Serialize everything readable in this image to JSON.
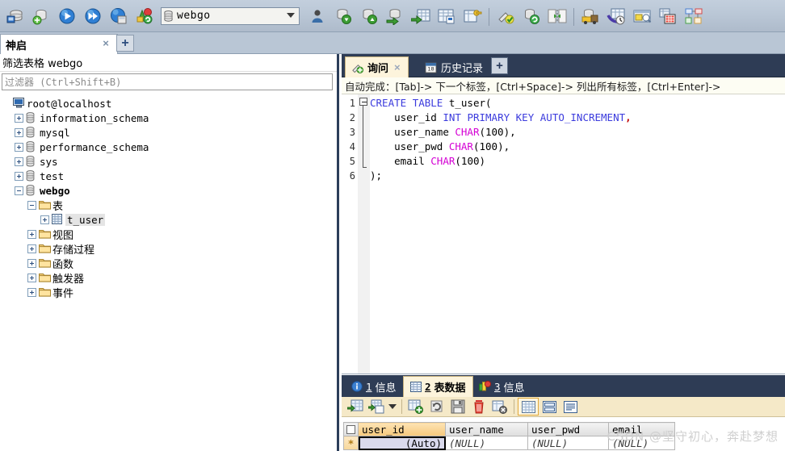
{
  "toolbar": {
    "db_selector": {
      "value": "webgo",
      "icon": "database-icon"
    },
    "buttons": [
      {
        "name": "connect-icon",
        "title": "连接"
      },
      {
        "name": "new-connection-icon",
        "title": "新建连接"
      },
      {
        "name": "execute-icon",
        "title": "执行"
      },
      {
        "name": "execute-all-icon",
        "title": "执行全部"
      },
      {
        "name": "stop-icon",
        "title": "停止"
      },
      {
        "name": "refresh-objects-icon",
        "title": "刷新"
      },
      {
        "name": "user-manager-icon",
        "title": "用户管理"
      },
      {
        "name": "backup-database-icon",
        "title": "备份数据库"
      },
      {
        "name": "restore-database-icon",
        "title": "还原数据库"
      },
      {
        "name": "import-data-icon",
        "title": "导入数据"
      },
      {
        "name": "export-grid-icon",
        "title": "导出表格"
      },
      {
        "name": "table-diagnostics-icon",
        "title": "表诊断"
      },
      {
        "name": "manage-index-icon",
        "title": "索引管理"
      },
      {
        "name": "query-builder-icon",
        "title": "查询生成器"
      },
      {
        "name": "schema-sync-icon",
        "title": "结构同步"
      },
      {
        "name": "data-sync-icon",
        "title": "数据同步"
      },
      {
        "name": "scheduled-backup-icon",
        "title": "计划备份"
      },
      {
        "name": "sql-scheduler-icon",
        "title": "SQL 调度"
      },
      {
        "name": "form-view-icon",
        "title": "表单视图"
      },
      {
        "name": "html-export-icon",
        "title": "HTML 导出"
      },
      {
        "name": "schema-designer-icon",
        "title": "结构设计器"
      }
    ]
  },
  "connection_tab": {
    "label": "神启",
    "close": "×",
    "add": "+"
  },
  "left_panel": {
    "title": "筛选表格 webgo",
    "filter_placeholder": "过滤器 (Ctrl+Shift+B)",
    "tree": [
      {
        "label": "root@localhost",
        "icon": "host-icon",
        "indent": 0,
        "expander": "none",
        "bold": false,
        "cjk": false
      },
      {
        "label": "information_schema",
        "icon": "database-icon",
        "indent": 1,
        "expander": "plus",
        "bold": false,
        "cjk": false
      },
      {
        "label": "mysql",
        "icon": "database-icon",
        "indent": 1,
        "expander": "plus",
        "bold": false,
        "cjk": false
      },
      {
        "label": "performance_schema",
        "icon": "database-icon",
        "indent": 1,
        "expander": "plus",
        "bold": false,
        "cjk": false
      },
      {
        "label": "sys",
        "icon": "database-icon",
        "indent": 1,
        "expander": "plus",
        "bold": false,
        "cjk": false
      },
      {
        "label": "test",
        "icon": "database-icon",
        "indent": 1,
        "expander": "plus",
        "bold": false,
        "cjk": false
      },
      {
        "label": "webgo",
        "icon": "database-icon",
        "indent": 1,
        "expander": "minus",
        "bold": true,
        "cjk": false
      },
      {
        "label": "表",
        "icon": "folder-icon",
        "indent": 2,
        "expander": "minus",
        "bold": false,
        "cjk": true
      },
      {
        "label": "t_user",
        "icon": "table-icon",
        "indent": 3,
        "expander": "plus",
        "bold": false,
        "cjk": false,
        "selected": true
      },
      {
        "label": "视图",
        "icon": "folder-icon",
        "indent": 2,
        "expander": "plus",
        "bold": false,
        "cjk": true
      },
      {
        "label": "存储过程",
        "icon": "folder-icon",
        "indent": 2,
        "expander": "plus",
        "bold": false,
        "cjk": true
      },
      {
        "label": "函数",
        "icon": "folder-icon",
        "indent": 2,
        "expander": "plus",
        "bold": false,
        "cjk": true
      },
      {
        "label": "触发器",
        "icon": "folder-icon",
        "indent": 2,
        "expander": "plus",
        "bold": false,
        "cjk": true
      },
      {
        "label": "事件",
        "icon": "folder-icon",
        "indent": 2,
        "expander": "plus",
        "bold": false,
        "cjk": true
      }
    ]
  },
  "query_panel": {
    "tabs": [
      {
        "label": "询问",
        "icon": "query-icon",
        "active": true,
        "closable": true
      },
      {
        "label": "历史记录",
        "icon": "calendar-icon",
        "active": false,
        "closable": false
      }
    ],
    "add_tab": "+",
    "close_tab": "×",
    "autocomplete_hint": "自动完成：[Tab]-> 下一个标签，[Ctrl+Space]-> 列出所有标签，[Ctrl+Enter]->",
    "editor": {
      "line_numbers": [
        "1",
        "2",
        "3",
        "4",
        "5",
        "6"
      ],
      "lines": [
        [
          {
            "t": "CREATE",
            "c": "kw"
          },
          {
            "t": " ",
            "c": "pn"
          },
          {
            "t": "TABLE",
            "c": "kw"
          },
          {
            "t": " ",
            "c": "pn"
          },
          {
            "t": "t_user",
            "c": "id"
          },
          {
            "t": "(",
            "c": "pn"
          }
        ],
        [
          {
            "t": "    ",
            "c": "pn"
          },
          {
            "t": "user_id",
            "c": "id"
          },
          {
            "t": " ",
            "c": "pn"
          },
          {
            "t": "INT",
            "c": "kw"
          },
          {
            "t": " ",
            "c": "pn"
          },
          {
            "t": "PRIMARY",
            "c": "kw"
          },
          {
            "t": " ",
            "c": "pn"
          },
          {
            "t": "KEY",
            "c": "kw"
          },
          {
            "t": " ",
            "c": "pn"
          },
          {
            "t": "AUTO_INCREMENT",
            "c": "kw"
          },
          {
            "t": ",",
            "c": "cm"
          }
        ],
        [
          {
            "t": "    ",
            "c": "pn"
          },
          {
            "t": "user_name",
            "c": "id"
          },
          {
            "t": " ",
            "c": "pn"
          },
          {
            "t": "CHAR",
            "c": "tp"
          },
          {
            "t": "(100),",
            "c": "pn"
          }
        ],
        [
          {
            "t": "    ",
            "c": "pn"
          },
          {
            "t": "user_pwd",
            "c": "id"
          },
          {
            "t": " ",
            "c": "pn"
          },
          {
            "t": "CHAR",
            "c": "tp"
          },
          {
            "t": "(100),",
            "c": "pn"
          }
        ],
        [
          {
            "t": "    ",
            "c": "pn"
          },
          {
            "t": "email",
            "c": "id"
          },
          {
            "t": " ",
            "c": "pn"
          },
          {
            "t": "CHAR",
            "c": "tp"
          },
          {
            "t": "(100)",
            "c": "pn"
          }
        ],
        [
          {
            "t": ");",
            "c": "pn"
          }
        ]
      ]
    }
  },
  "results_panel": {
    "tabs": [
      {
        "num": "1",
        "label": "信息",
        "icon": "info-icon",
        "active": false
      },
      {
        "num": "2",
        "label": "表数据",
        "icon": "grid-icon",
        "active": true
      },
      {
        "num": "3",
        "label": "信息",
        "icon": "chart-icon",
        "active": false
      }
    ],
    "toolbar_buttons": [
      {
        "name": "insert-row-icon"
      },
      {
        "name": "insert-row-options-icon"
      },
      {
        "name": "dropdown-arrow-icon"
      },
      {
        "name": "add-record-icon"
      },
      {
        "name": "refresh-data-icon"
      },
      {
        "name": "save-changes-icon"
      },
      {
        "name": "delete-record-icon"
      },
      {
        "name": "clear-filter-icon"
      },
      {
        "name": "grid-view-icon"
      },
      {
        "name": "form-view-icon"
      },
      {
        "name": "text-view-icon"
      }
    ],
    "grid": {
      "columns": [
        "user_id",
        "user_name",
        "user_pwd",
        "email"
      ],
      "selected_column": "user_id",
      "row_marker": "*",
      "rows": [
        [
          "(Auto)",
          "(NULL)",
          "(NULL)",
          "(NULL)"
        ]
      ]
    }
  },
  "watermark": "CSDN @坚守初心，奔赴梦想",
  "colors": {
    "toolbar_bg": "#bac7d6",
    "panel_border": "#2c3e5a",
    "tab_active_bg": "#fdf4dc",
    "tab_strip_bg": "#2e3c55",
    "keyword": "#3b3bdd",
    "type": "#d400d4",
    "selected_header": "#f6c97c"
  }
}
